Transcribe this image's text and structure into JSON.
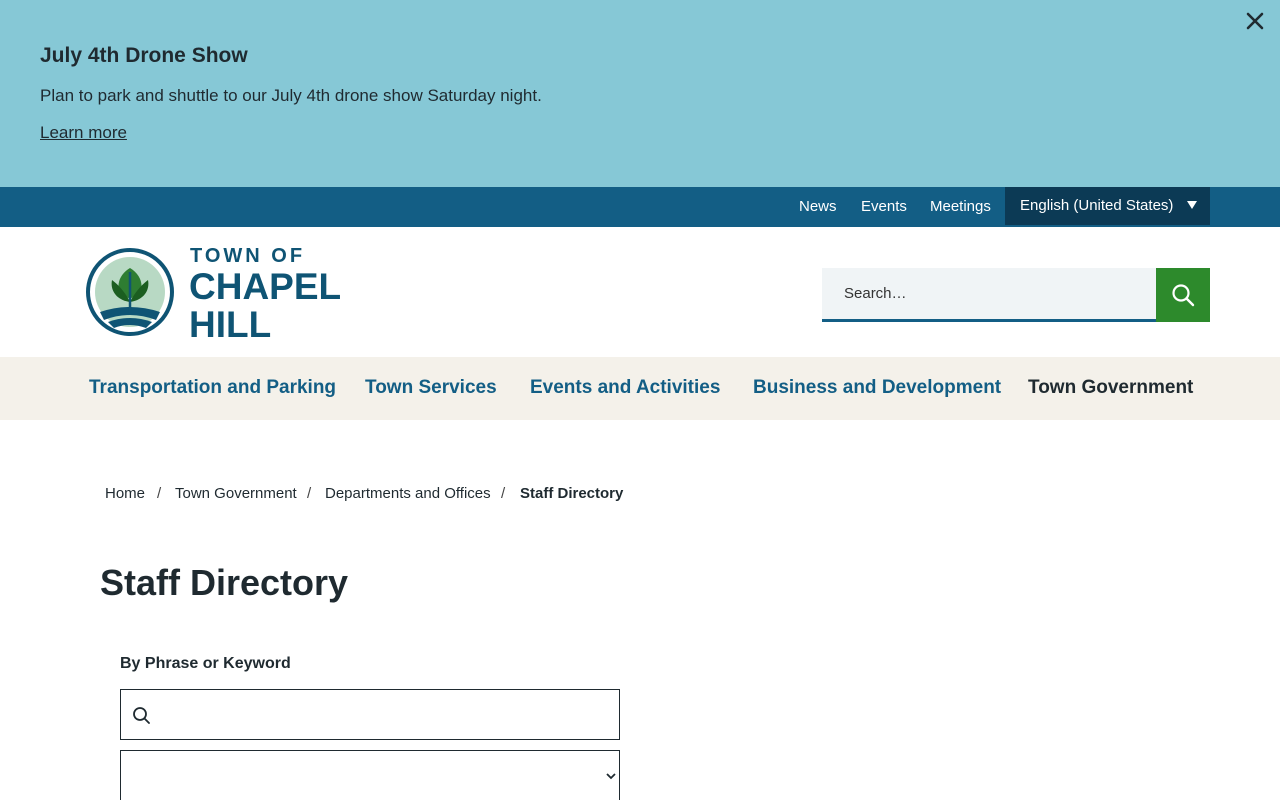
{
  "alert": {
    "title": "July 4th Drone Show",
    "text": "Plan to park and shuttle to our July 4th drone show Saturday night.",
    "link": "Learn more"
  },
  "utility": {
    "links": [
      "News",
      "Events",
      "Meetings"
    ],
    "language": "English (United States)"
  },
  "logo": {
    "line1": "TOWN OF",
    "line2": "CHAPEL",
    "line3": "HILL"
  },
  "search": {
    "placeholder": "Search…"
  },
  "nav": {
    "items": [
      "Transportation and Parking",
      "Town Services",
      "Events and Activities",
      "Business and Development",
      "Town Government"
    ]
  },
  "breadcrumb": {
    "items": [
      "Home",
      "Town Government",
      "Departments and Offices"
    ],
    "separator": "/",
    "current": "Staff Directory"
  },
  "page": {
    "title": "Staff Directory",
    "filter_label": "By Phrase or Keyword",
    "keyword_value": "",
    "select_value": ""
  },
  "colors": {
    "alert_bg": "#86c8d6",
    "utility_bg": "#135e85",
    "language_bg": "#0c3a55",
    "brand_blue": "#0f5474",
    "search_button": "#2d8a2c",
    "nav_bg": "#f4f1ea"
  }
}
